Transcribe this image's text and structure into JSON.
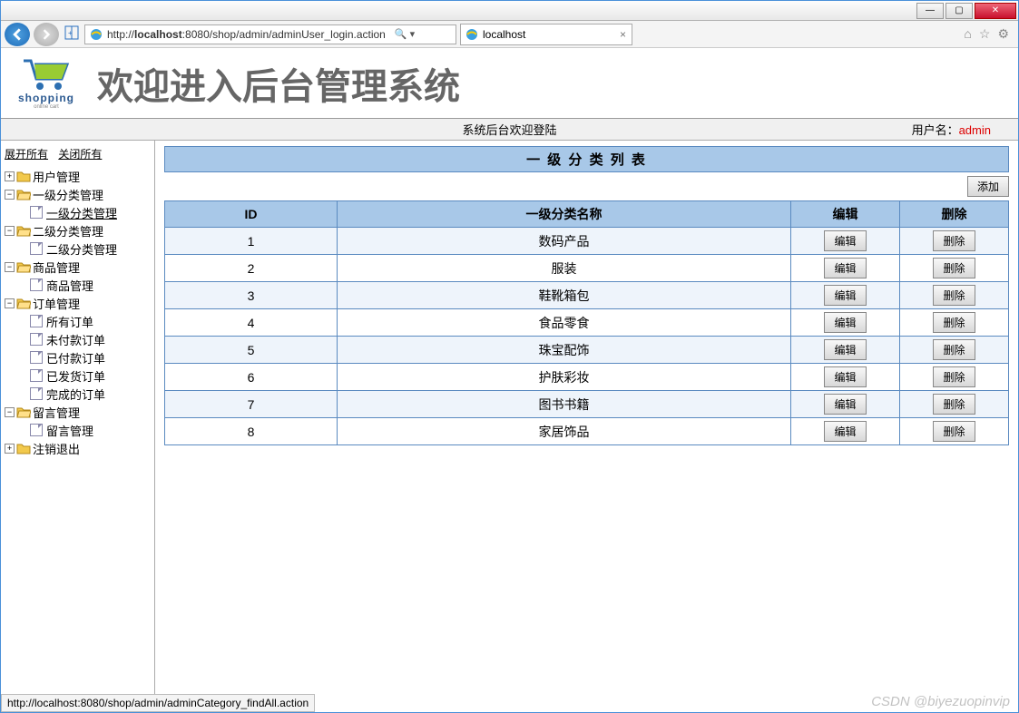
{
  "window": {
    "min": "—",
    "max": "▢",
    "close": "✕"
  },
  "nav": {
    "url_prefix": "http://",
    "url_host": "localhost",
    "url_rest": ":8080/shop/admin/adminUser_login.action",
    "search_hint": "🔍 ▾",
    "tab_title": "localhost"
  },
  "tools": {
    "home": "⌂",
    "star": "☆",
    "gear": "⚙"
  },
  "logo": {
    "name": "shopping",
    "sub": "online cart"
  },
  "header_title": "欢迎进入后台管理系统",
  "status": {
    "center": "系统后台欢迎登陆",
    "user_label": "用户名：",
    "user_name": "admin"
  },
  "side": {
    "expand_all": "展开所有",
    "collapse_all": "关闭所有",
    "nodes": [
      {
        "pm": "+",
        "label": "用户管理",
        "open": false
      },
      {
        "pm": "−",
        "label": "一级分类管理",
        "open": true,
        "children": [
          {
            "label": "一级分类管理",
            "active": true
          }
        ]
      },
      {
        "pm": "−",
        "label": "二级分类管理",
        "open": true,
        "children": [
          {
            "label": "二级分类管理"
          }
        ]
      },
      {
        "pm": "−",
        "label": "商品管理",
        "open": true,
        "children": [
          {
            "label": "商品管理"
          }
        ]
      },
      {
        "pm": "−",
        "label": "订单管理",
        "open": true,
        "children": [
          {
            "label": "所有订单"
          },
          {
            "label": "未付款订单"
          },
          {
            "label": "已付款订单"
          },
          {
            "label": "已发货订单"
          },
          {
            "label": "完成的订单"
          }
        ]
      },
      {
        "pm": "−",
        "label": "留言管理",
        "open": true,
        "children": [
          {
            "label": "留言管理"
          }
        ]
      },
      {
        "pm": "+",
        "label": "注销退出",
        "open": false
      }
    ]
  },
  "panel": {
    "title": "一 级 分 类 列 表",
    "add": "添加",
    "cols": {
      "id": "ID",
      "name": "一级分类名称",
      "edit": "编辑",
      "del": "删除"
    },
    "edit_btn": "编辑",
    "del_btn": "删除",
    "rows": [
      {
        "id": "1",
        "name": "数码产品"
      },
      {
        "id": "2",
        "name": "服装"
      },
      {
        "id": "3",
        "name": "鞋靴箱包"
      },
      {
        "id": "4",
        "name": "食品零食"
      },
      {
        "id": "5",
        "name": "珠宝配饰"
      },
      {
        "id": "6",
        "name": "护肤彩妆"
      },
      {
        "id": "7",
        "name": "图书书籍"
      },
      {
        "id": "8",
        "name": "家居饰品"
      }
    ]
  },
  "footer_link": "http://localhost:8080/shop/admin/adminCategory_findAll.action",
  "watermark": "CSDN @biyezuopinvip"
}
